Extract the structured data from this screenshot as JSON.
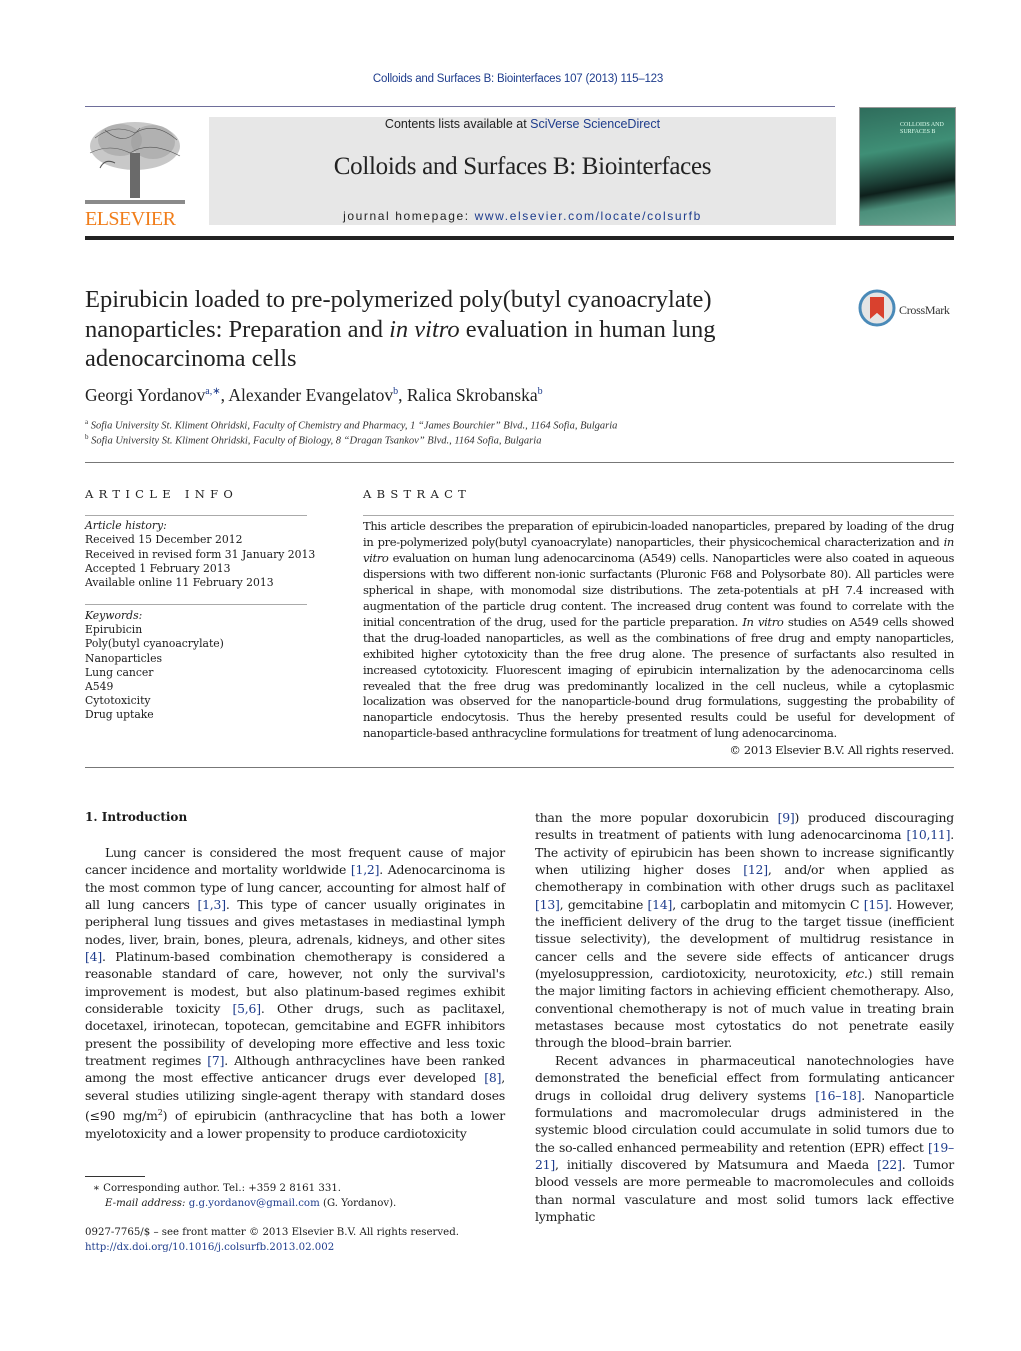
{
  "header": {
    "citation": "Colloids and Surfaces B: Biointerfaces 107 (2013) 115–123",
    "contents_prefix": "Contents lists available at ",
    "contents_link": "SciVerse ScienceDirect",
    "journal_title": "Colloids and Surfaces B: Biointerfaces",
    "homepage_prefix": "journal homepage: ",
    "homepage_link": "www.elsevier.com/locate/colsurfb",
    "publisher_logo_text": "ELSEVIER",
    "cover_title_line1": "COLLOIDS AND",
    "cover_title_line2": "SURFACES B",
    "brand_colors": {
      "elsevier_orange": "#f07d1a",
      "link_blue": "#1e3c8c",
      "banner_gray": "#e7e7e7"
    }
  },
  "article": {
    "title_part1": "Epirubicin loaded to pre-polymerized poly(butyl cyanoacrylate) nanoparticles: Preparation and ",
    "title_italic": "in vitro",
    "title_part2": " evaluation in human lung adenocarcinoma cells",
    "crossmark_label": "CrossMark",
    "authors": [
      {
        "name": "Georgi Yordanov",
        "sup": "a,∗"
      },
      {
        "name": "Alexander Evangelatov",
        "sup": "b"
      },
      {
        "name": "Ralica Skrobanska",
        "sup": "b"
      }
    ],
    "affiliations": [
      {
        "mark": "a",
        "text": "Sofia University St. Kliment Ohridski, Faculty of Chemistry and Pharmacy, 1 “James Bourchier” Blvd., 1164 Sofia, Bulgaria"
      },
      {
        "mark": "b",
        "text": "Sofia University St. Kliment Ohridski, Faculty of Biology, 8 “Dragan Tsankov” Blvd., 1164 Sofia, Bulgaria"
      }
    ]
  },
  "article_info": {
    "heading": "ARTICLE INFO",
    "history_label": "Article history:",
    "history": [
      "Received 15 December 2012",
      "Received in revised form 31 January 2013",
      "Accepted 1 February 2013",
      "Available online 11 February 2013"
    ],
    "keywords_label": "Keywords:",
    "keywords": [
      "Epirubicin",
      "Poly(butyl cyanoacrylate)",
      "Nanoparticles",
      "Lung cancer",
      "A549",
      "Cytotoxicity",
      "Drug uptake"
    ]
  },
  "abstract": {
    "heading": "ABSTRACT",
    "s1": "This article describes the preparation of epirubicin-loaded nanoparticles, prepared by loading of the drug in pre-polymerized poly(butyl cyanoacrylate) nanoparticles, their physicochemical characterization and ",
    "s1_it": "in vitro",
    "s2": " evaluation on human lung adenocarcinoma (A549) cells. Nanoparticles were also coated in aqueous dispersions with two different non-ionic surfactants (Pluronic F68 and Polysorbate 80). All particles were spherical in shape, with monomodal size distributions. The zeta-potentials at pH 7.4 increased with augmentation of the particle drug content. The increased drug content was found to correlate with the initial concentration of the drug, used for the particle preparation. ",
    "s2_it": "In vitro",
    "s3": " studies on A549 cells showed that the drug-loaded nanoparticles, as well as the combinations of free drug and empty nanoparticles, exhibited higher cytotoxicity than the free drug alone. The presence of surfactants also resulted in increased cytotoxicity. Fluorescent imaging of epirubicin internalization by the adenocarcinoma cells revealed that the free drug was predominantly localized in the cell nucleus, while a cytoplasmic localization was observed for the nanoparticle-bound drug formulations, suggesting the probability of nanoparticle endocytosis. Thus the hereby presented results could be useful for development of nanoparticle-based anthracycline formulations for treatment of lung adenocarcinoma.",
    "copyright": "© 2013 Elsevier B.V. All rights reserved."
  },
  "introduction": {
    "heading": "1.  Introduction",
    "left_p1": [
      {
        "t": "Lung cancer is considered the most frequent cause of major cancer incidence and mortality worldwide "
      },
      {
        "ref": "[1,2]"
      },
      {
        "t": ". Adenocarcinoma is the most common type of lung cancer, accounting for almost half of all lung cancers "
      },
      {
        "ref": "[1,3]"
      },
      {
        "t": ". This type of cancer usually originates in peripheral lung tissues and gives metastases in mediastinal lymph nodes, liver, brain, bones, pleura, adrenals, kidneys, and other sites "
      },
      {
        "ref": "[4]"
      },
      {
        "t": ". Platinum-based combination chemotherapy is considered a reasonable standard of care, however, not only the survival's improvement is modest, but also platinum-based regimes exhibit considerable toxicity "
      },
      {
        "ref": "[5,6]"
      },
      {
        "t": ". Other drugs, such as paclitaxel, docetaxel, irinotecan, topotecan, gemcitabine and EGFR inhibitors present the possibility of developing more effective and less toxic treatment regimes "
      },
      {
        "ref": "[7]"
      },
      {
        "t": ". Although anthracyclines have been ranked among the most effective anticancer drugs ever developed "
      },
      {
        "ref": "[8]"
      },
      {
        "t": ", several studies utilizing single-agent therapy with standard doses (≤90 mg/m"
      },
      {
        "sup": "2"
      },
      {
        "t": ") of epirubicin (anthracycline that has both a lower myelotoxicity and a lower propensity to produce cardiotoxicity"
      }
    ],
    "right_p1": [
      {
        "t": "than the more popular doxorubicin "
      },
      {
        "ref": "[9]"
      },
      {
        "t": ") produced discouraging results in treatment of patients with lung adenocarcinoma "
      },
      {
        "ref": "[10,11]"
      },
      {
        "t": ". The activity of epirubicin has been shown to increase significantly when utilizing higher doses "
      },
      {
        "ref": "[12]"
      },
      {
        "t": ", and/or when applied as chemotherapy in combination with other drugs such as paclitaxel "
      },
      {
        "ref": "[13]"
      },
      {
        "t": ", gemcitabine "
      },
      {
        "ref": "[14]"
      },
      {
        "t": ", carboplatin and mitomycin C "
      },
      {
        "ref": "[15]"
      },
      {
        "t": ". However, the inefficient delivery of the drug to the target tissue (inefficient tissue selectivity), the development of multidrug resistance in cancer cells and the severe side effects of anticancer drugs (myelosuppression, cardiotoxicity, neurotoxicity, "
      },
      {
        "it": "etc."
      },
      {
        "t": ") still remain the major limiting factors in achieving efficient chemotherapy. Also, conventional chemotherapy is not of much value in treating brain metastases because most cytostatics do not penetrate easily through the blood–brain barrier."
      }
    ],
    "right_p2": [
      {
        "t": "Recent advances in pharmaceutical nanotechnologies have demonstrated the beneficial effect from formulating anticancer drugs in colloidal drug delivery systems "
      },
      {
        "ref": "[16–18]"
      },
      {
        "t": ". Nanoparticle formulations and macromolecular drugs administered in the systemic blood circulation could accumulate in solid tumors due to the so-called enhanced permeability and retention (EPR) effect "
      },
      {
        "ref": "[19–21]"
      },
      {
        "t": ", initially discovered by Matsumura and Maeda "
      },
      {
        "ref": "[22]"
      },
      {
        "t": ". Tumor blood vessels are more permeable to macromolecules and colloids than normal vasculature and most solid tumors lack effective lymphatic"
      }
    ]
  },
  "footnotes": {
    "corresponding": "∗  Corresponding author. Tel.: +359 2 8161 331.",
    "email_label": "E-mail address: ",
    "email": "g.g.yordanov@gmail.com",
    "email_suffix": " (G. Yordanov).",
    "front_matter": "0927-7765/$ – see front matter © 2013 Elsevier B.V. All rights reserved.",
    "doi": "http://dx.doi.org/10.1016/j.colsurfb.2013.02.002"
  }
}
